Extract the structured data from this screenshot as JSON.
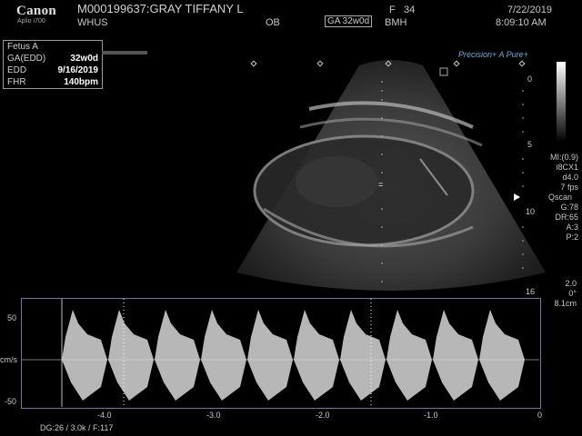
{
  "header": {
    "brand": "Canon",
    "model": "Aplio i700",
    "patient": "M000199637:GRAY TIFFANY L",
    "dept": "WHUS",
    "exam": "OB",
    "ga": "GA 32w0d",
    "facility": "BMH",
    "sex": "F",
    "age": "34",
    "date": "7/22/2019",
    "time": "8:09:10 AM"
  },
  "fetus": {
    "title": "Fetus A",
    "rows": [
      {
        "label": "GA(EDD)",
        "value": "32w0d"
      },
      {
        "label": "EDD",
        "value": "9/16/2019"
      },
      {
        "label": "FHR",
        "value": "140bpm"
      }
    ]
  },
  "precision": "Precision+ A Pure+",
  "depth_scale": [
    "0",
    "5",
    "10",
    "16"
  ],
  "params": [
    "MI:(0.9)",
    "i8CX1",
    "d4.0",
    "7 fps",
    "Qscan",
    "G:78",
    "DR:65",
    "A:3",
    "P:2"
  ],
  "doppler_params": [
    "2.0",
    "0°",
    "8.1cm"
  ],
  "doppler": {
    "y_ticks": [
      "50",
      "cm/s",
      "-50"
    ],
    "x_ticks": [
      "-4.0",
      "-3.0",
      "-2.0",
      "-1.0",
      "0"
    ],
    "footer": "DG:26  / 3.0k  / F:117"
  },
  "colors": {
    "frame": "#6f76a8",
    "accent": "#6fa8d8"
  }
}
